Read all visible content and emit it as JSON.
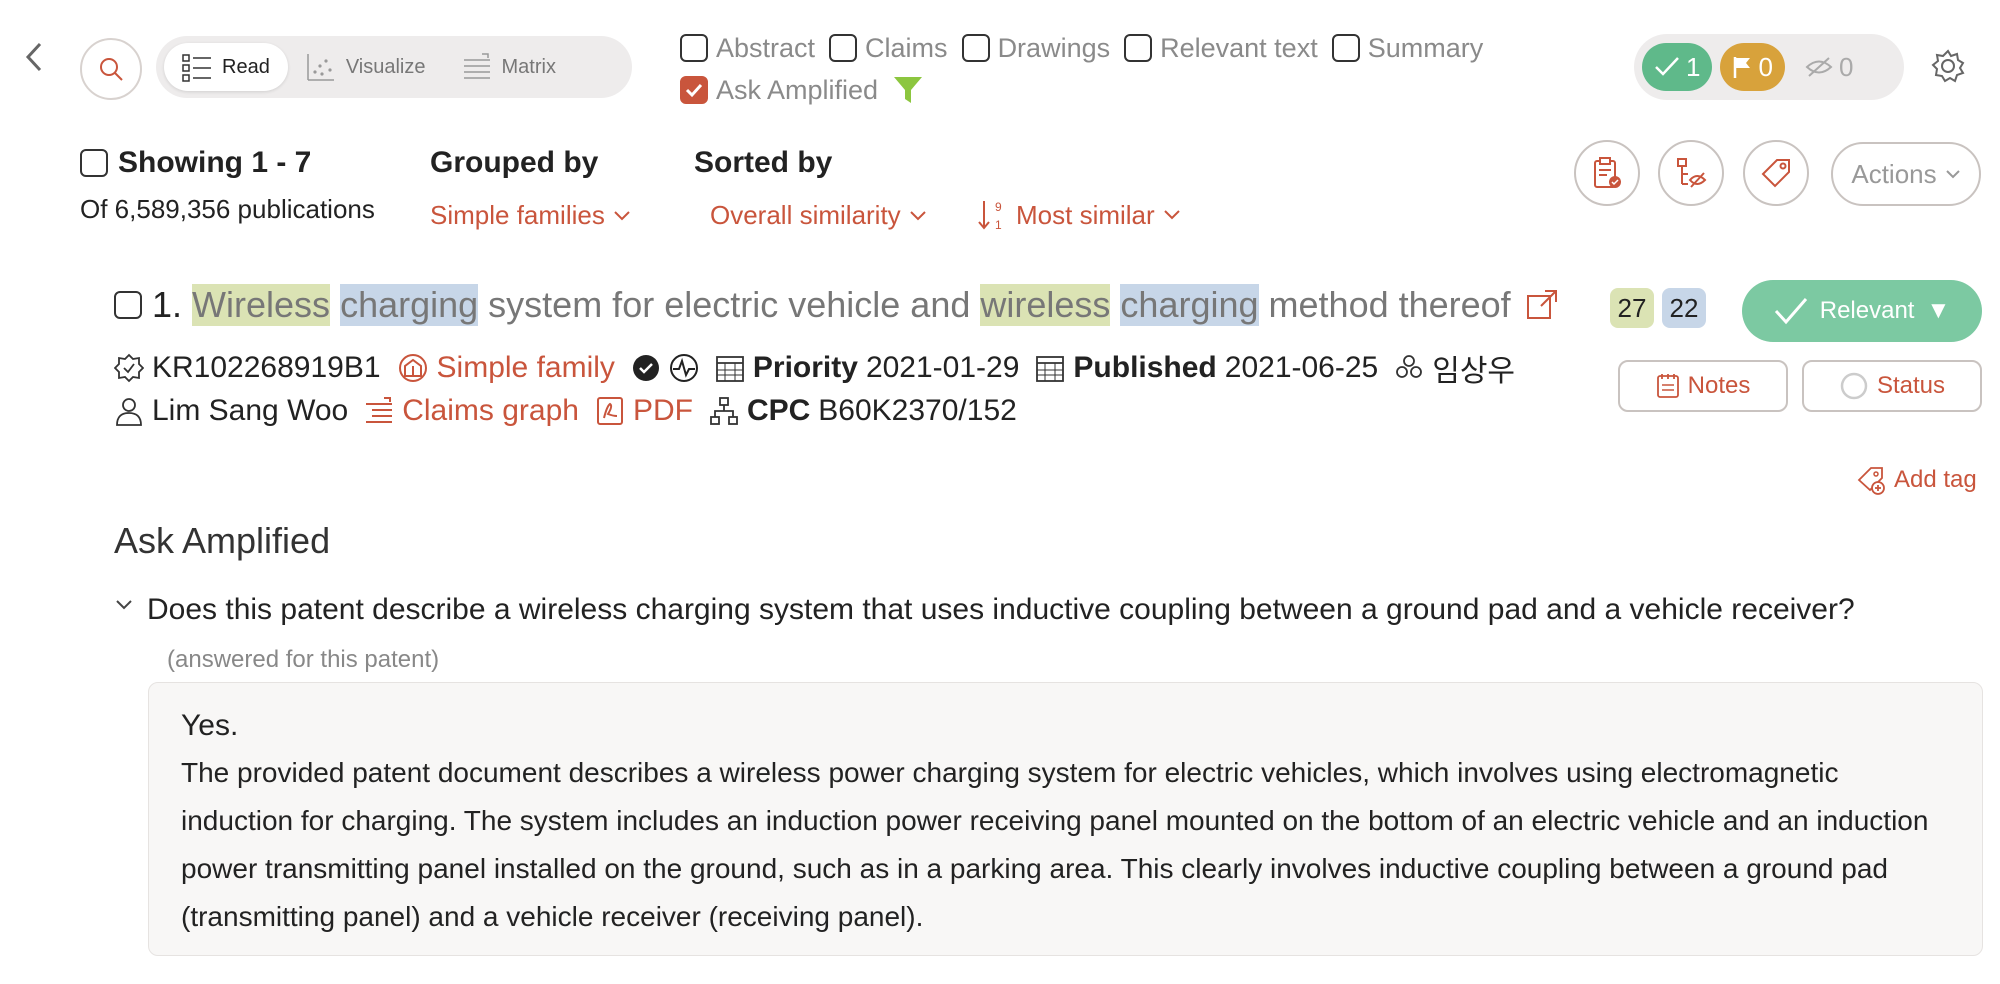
{
  "toolbar": {
    "modes": [
      {
        "label": "Read",
        "active": true
      },
      {
        "label": "Visualize",
        "active": false
      },
      {
        "label": "Matrix",
        "active": false
      }
    ],
    "filters": [
      {
        "label": "Abstract",
        "checked": false
      },
      {
        "label": "Claims",
        "checked": false
      },
      {
        "label": "Drawings",
        "checked": false
      },
      {
        "label": "Relevant text",
        "checked": false
      },
      {
        "label": "Summary",
        "checked": false
      },
      {
        "label": "Ask Amplified",
        "checked": true
      }
    ],
    "counters": {
      "relevant": "1",
      "flagged": "0",
      "hidden": "0"
    }
  },
  "results": {
    "showing": "Showing 1 - 7",
    "of_publications": "Of 6,589,356 publications",
    "grouped_by_label": "Grouped by",
    "grouped_by_value": "Simple families",
    "sorted_by_label": "Sorted by",
    "sorted_by_value": "Overall similarity",
    "order_value": "Most similar",
    "actions_label": "Actions"
  },
  "item": {
    "index": "1.",
    "title_parts": [
      "Wireless",
      "charging",
      "system for electric vehicle and",
      "wireless",
      "charging",
      "method thereof"
    ],
    "score_green": "27",
    "score_blue": "22",
    "relevant_label": "Relevant",
    "pub_number": "KR102268919B1",
    "simple_family": "Simple family",
    "priority_label": "Priority",
    "priority_date": "2021-01-29",
    "published_label": "Published",
    "published_date": "2021-06-25",
    "assignee": "임상우",
    "inventor": "Lim Sang Woo",
    "claims_graph": "Claims graph",
    "pdf": "PDF",
    "cpc_label": "CPC",
    "cpc_value": "B60K2370/152",
    "notes_label": "Notes",
    "status_label": "Status",
    "add_tag": "Add tag"
  },
  "ask": {
    "heading": "Ask Amplified",
    "question": "Does this patent describe a wireless charging system that uses inductive coupling between a ground pad and a vehicle receiver?",
    "question_note": "(answered for this patent)",
    "answer_short": "Yes.",
    "answer_body": "The provided patent document describes a wireless power charging system for electric vehicles, which involves using electromagnetic induction for charging. The system includes an induction power receiving panel mounted on the bottom of an electric vehicle and an induction power transmitting panel installed on the ground, such as in a parking area. This clearly involves inductive coupling between a ground pad (transmitting panel) and a vehicle receiver (receiving panel)."
  },
  "colors": {
    "accent": "#c9553c",
    "relevant_green": "#7cc9a2",
    "flag_gold": "#d8a23b",
    "highlight_green": "#dbe3b4",
    "highlight_blue": "#c7d6e8"
  }
}
